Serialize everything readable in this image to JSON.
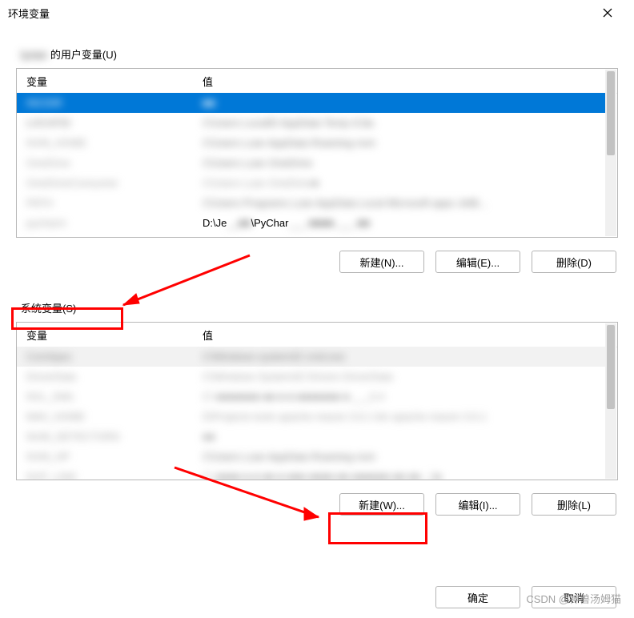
{
  "title": "环境变量",
  "user_section": {
    "title_suffix": " 的用户变量(U)",
    "header_var": "变量",
    "header_val": "值",
    "buttons": {
      "new": "新建(N)...",
      "edit": "编辑(E)...",
      "del": "删除(D)"
    }
  },
  "system_section": {
    "title": "系统变量(S)",
    "header_var": "变量",
    "header_val": "值",
    "buttons": {
      "new": "新建(W)...",
      "edit": "编辑(I)...",
      "del": "删除(L)"
    }
  },
  "bottom": {
    "ok": "确定",
    "cancel": "取消"
  },
  "watermark": "CSDN @神兽汤姆猫"
}
